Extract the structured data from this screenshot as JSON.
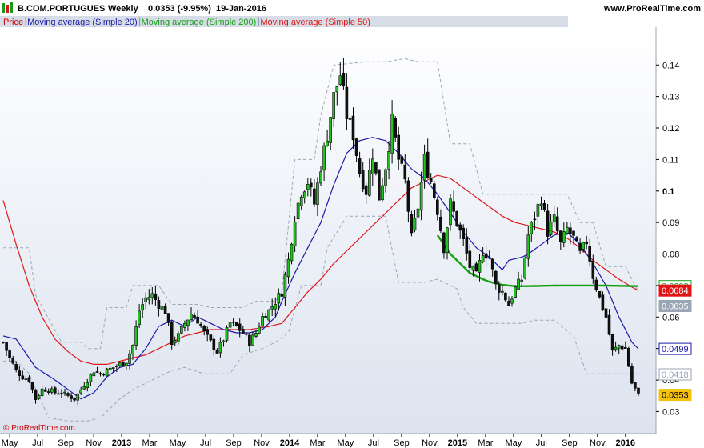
{
  "header": {
    "instrument": "B.COM.PORTUGUES",
    "period": "Weekly",
    "last_change": "0.0353 (-9.95%)",
    "date": "19-Jan-2016",
    "site": "www.ProRealTime.com"
  },
  "legend": [
    {
      "label": "Price",
      "color": "#cc0000"
    },
    {
      "label": "Moving average (Simple 20)",
      "color": "#1a1aa8"
    },
    {
      "label": "Moving average (Simple 200)",
      "color": "#13a013"
    },
    {
      "label": "Moving average (Simple 50)",
      "color": "#e01616"
    }
  ],
  "credit": "© ProRealTime.com",
  "chart_data": {
    "type": "candlestick",
    "x_axis": {
      "tick_labels": [
        "May",
        "Jul",
        "Sep",
        "Nov",
        "2013",
        "Mar",
        "May",
        "Jul",
        "Sep",
        "Nov",
        "2014",
        "Mar",
        "May",
        "Jul",
        "Sep",
        "Nov",
        "2015",
        "Mar",
        "May",
        "Jul",
        "Sep",
        "Nov",
        "2016"
      ],
      "bold_labels": [
        "2013",
        "2014",
        "2015",
        "2016"
      ],
      "week_index_range": [
        0,
        196
      ]
    },
    "y_axis": {
      "ticks": [
        0.03,
        0.04,
        0.05,
        0.06,
        0.07,
        0.08,
        0.09,
        0.1,
        0.11,
        0.12,
        0.13,
        0.14
      ],
      "tick_labels": [
        "0.03",
        "0.04",
        "0.05",
        "0.06",
        "0.07",
        "0.08",
        "0.09",
        "0.1",
        "0.11",
        "0.12",
        "0.13",
        "0.14"
      ],
      "bold_ticks": [
        "0.1"
      ],
      "range": [
        0.023,
        0.152
      ],
      "position": "right"
    },
    "value_badges": [
      {
        "value": 0.0698,
        "label": "0.0698",
        "color": "#13a013",
        "style": "outline"
      },
      {
        "value": 0.0684,
        "label": "0.0684",
        "color": "#e01616",
        "style": "fill"
      },
      {
        "value": 0.0635,
        "label": "0.0635",
        "color": "#9aa6b4",
        "style": "fill"
      },
      {
        "value": 0.0499,
        "label": "0.0499",
        "color": "#1a1aa8",
        "style": "outline"
      },
      {
        "value": 0.0418,
        "label": "0.0418",
        "color": "#9aa6b4",
        "style": "outline"
      },
      {
        "value": 0.0353,
        "label": "0.0353",
        "color": "#f4c20d",
        "style": "fill"
      }
    ],
    "close_series_anchors": [
      [
        0,
        0.052
      ],
      [
        2,
        0.047
      ],
      [
        4,
        0.043
      ],
      [
        6,
        0.041
      ],
      [
        8,
        0.04
      ],
      [
        10,
        0.034
      ],
      [
        12,
        0.037
      ],
      [
        14,
        0.037
      ],
      [
        16,
        0.036
      ],
      [
        18,
        0.036
      ],
      [
        20,
        0.035
      ],
      [
        22,
        0.034
      ],
      [
        24,
        0.037
      ],
      [
        26,
        0.04
      ],
      [
        28,
        0.043
      ],
      [
        30,
        0.042
      ],
      [
        32,
        0.043
      ],
      [
        34,
        0.044
      ],
      [
        36,
        0.045
      ],
      [
        38,
        0.046
      ],
      [
        40,
        0.051
      ],
      [
        42,
        0.062
      ],
      [
        44,
        0.066
      ],
      [
        46,
        0.067
      ],
      [
        48,
        0.064
      ],
      [
        50,
        0.062
      ],
      [
        52,
        0.052
      ],
      [
        54,
        0.054
      ],
      [
        56,
        0.058
      ],
      [
        58,
        0.061
      ],
      [
        60,
        0.059
      ],
      [
        62,
        0.055
      ],
      [
        64,
        0.052
      ],
      [
        66,
        0.049
      ],
      [
        68,
        0.053
      ],
      [
        70,
        0.058
      ],
      [
        72,
        0.057
      ],
      [
        74,
        0.055
      ],
      [
        76,
        0.052
      ],
      [
        78,
        0.055
      ],
      [
        80,
        0.06
      ],
      [
        82,
        0.062
      ],
      [
        84,
        0.065
      ],
      [
        86,
        0.068
      ],
      [
        88,
        0.078
      ],
      [
        90,
        0.092
      ],
      [
        92,
        0.1
      ],
      [
        94,
        0.103
      ],
      [
        96,
        0.096
      ],
      [
        98,
        0.108
      ],
      [
        100,
        0.118
      ],
      [
        102,
        0.13
      ],
      [
        104,
        0.137
      ],
      [
        106,
        0.124
      ],
      [
        108,
        0.118
      ],
      [
        110,
        0.106
      ],
      [
        112,
        0.1
      ],
      [
        114,
        0.112
      ],
      [
        116,
        0.098
      ],
      [
        118,
        0.108
      ],
      [
        120,
        0.122
      ],
      [
        122,
        0.11
      ],
      [
        124,
        0.103
      ],
      [
        126,
        0.085
      ],
      [
        128,
        0.095
      ],
      [
        130,
        0.11
      ],
      [
        132,
        0.103
      ],
      [
        134,
        0.094
      ],
      [
        136,
        0.082
      ],
      [
        138,
        0.096
      ],
      [
        140,
        0.09
      ],
      [
        142,
        0.084
      ],
      [
        144,
        0.076
      ],
      [
        146,
        0.073
      ],
      [
        148,
        0.081
      ],
      [
        150,
        0.079
      ],
      [
        152,
        0.07
      ],
      [
        154,
        0.068
      ],
      [
        156,
        0.064
      ],
      [
        158,
        0.069
      ],
      [
        160,
        0.072
      ],
      [
        162,
        0.086
      ],
      [
        164,
        0.092
      ],
      [
        166,
        0.098
      ],
      [
        168,
        0.087
      ],
      [
        170,
        0.091
      ],
      [
        172,
        0.083
      ],
      [
        174,
        0.088
      ],
      [
        176,
        0.085
      ],
      [
        178,
        0.08
      ],
      [
        180,
        0.084
      ],
      [
        182,
        0.073
      ],
      [
        184,
        0.066
      ],
      [
        186,
        0.06
      ],
      [
        188,
        0.049
      ],
      [
        190,
        0.051
      ],
      [
        192,
        0.05
      ],
      [
        194,
        0.039
      ],
      [
        196,
        0.0353
      ]
    ],
    "sma20_anchors": [
      [
        0,
        0.054
      ],
      [
        4,
        0.053
      ],
      [
        10,
        0.044
      ],
      [
        16,
        0.04
      ],
      [
        20,
        0.037
      ],
      [
        24,
        0.034
      ],
      [
        28,
        0.036
      ],
      [
        32,
        0.041
      ],
      [
        36,
        0.044
      ],
      [
        40,
        0.045
      ],
      [
        44,
        0.05
      ],
      [
        48,
        0.057
      ],
      [
        52,
        0.059
      ],
      [
        56,
        0.057
      ],
      [
        60,
        0.06
      ],
      [
        64,
        0.058
      ],
      [
        68,
        0.056
      ],
      [
        72,
        0.055
      ],
      [
        76,
        0.055
      ],
      [
        80,
        0.056
      ],
      [
        84,
        0.06
      ],
      [
        86,
        0.065
      ],
      [
        90,
        0.074
      ],
      [
        94,
        0.082
      ],
      [
        98,
        0.09
      ],
      [
        102,
        0.102
      ],
      [
        106,
        0.112
      ],
      [
        110,
        0.116
      ],
      [
        114,
        0.117
      ],
      [
        118,
        0.116
      ],
      [
        122,
        0.112
      ],
      [
        126,
        0.107
      ],
      [
        130,
        0.104
      ],
      [
        134,
        0.099
      ],
      [
        138,
        0.093
      ],
      [
        142,
        0.087
      ],
      [
        146,
        0.082
      ],
      [
        150,
        0.079
      ],
      [
        154,
        0.075
      ],
      [
        156,
        0.078
      ],
      [
        160,
        0.079
      ],
      [
        162,
        0.08
      ],
      [
        166,
        0.083
      ],
      [
        170,
        0.086
      ],
      [
        174,
        0.087
      ],
      [
        178,
        0.083
      ],
      [
        182,
        0.077
      ],
      [
        186,
        0.07
      ],
      [
        190,
        0.06
      ],
      [
        194,
        0.052
      ],
      [
        196,
        0.0499
      ]
    ],
    "sma50_anchors": [
      [
        0,
        0.097
      ],
      [
        4,
        0.083
      ],
      [
        8,
        0.07
      ],
      [
        12,
        0.06
      ],
      [
        16,
        0.053
      ],
      [
        20,
        0.049
      ],
      [
        24,
        0.046
      ],
      [
        28,
        0.045
      ],
      [
        32,
        0.045
      ],
      [
        36,
        0.046
      ],
      [
        40,
        0.047
      ],
      [
        44,
        0.048
      ],
      [
        48,
        0.05
      ],
      [
        52,
        0.052
      ],
      [
        56,
        0.054
      ],
      [
        60,
        0.055
      ],
      [
        64,
        0.056
      ],
      [
        70,
        0.056
      ],
      [
        76,
        0.056
      ],
      [
        82,
        0.057
      ],
      [
        86,
        0.058
      ],
      [
        90,
        0.063
      ],
      [
        94,
        0.068
      ],
      [
        98,
        0.072
      ],
      [
        102,
        0.077
      ],
      [
        106,
        0.081
      ],
      [
        110,
        0.085
      ],
      [
        114,
        0.089
      ],
      [
        118,
        0.093
      ],
      [
        122,
        0.097
      ],
      [
        126,
        0.101
      ],
      [
        130,
        0.103
      ],
      [
        134,
        0.105
      ],
      [
        138,
        0.104
      ],
      [
        142,
        0.101
      ],
      [
        146,
        0.098
      ],
      [
        150,
        0.095
      ],
      [
        154,
        0.092
      ],
      [
        158,
        0.09
      ],
      [
        162,
        0.089
      ],
      [
        166,
        0.088
      ],
      [
        170,
        0.087
      ],
      [
        174,
        0.085
      ],
      [
        178,
        0.082
      ],
      [
        182,
        0.078
      ],
      [
        186,
        0.075
      ],
      [
        190,
        0.072
      ],
      [
        194,
        0.0695
      ],
      [
        196,
        0.0684
      ]
    ],
    "sma200_anchors": [
      [
        134,
        0.086
      ],
      [
        136,
        0.083
      ],
      [
        138,
        0.08
      ],
      [
        140,
        0.078
      ],
      [
        142,
        0.076
      ],
      [
        144,
        0.074
      ],
      [
        146,
        0.073
      ],
      [
        148,
        0.072
      ],
      [
        150,
        0.0712
      ],
      [
        154,
        0.0702
      ],
      [
        158,
        0.0698
      ],
      [
        162,
        0.0698
      ],
      [
        166,
        0.0699
      ],
      [
        172,
        0.07
      ],
      [
        178,
        0.07
      ],
      [
        184,
        0.07
      ],
      [
        190,
        0.0699
      ],
      [
        196,
        0.0698
      ]
    ],
    "envelope_upper_anchors": [
      [
        0,
        0.082
      ],
      [
        8,
        0.082
      ],
      [
        10,
        0.067
      ],
      [
        18,
        0.052
      ],
      [
        24,
        0.052
      ],
      [
        26,
        0.05
      ],
      [
        30,
        0.05
      ],
      [
        32,
        0.063
      ],
      [
        38,
        0.063
      ],
      [
        40,
        0.07
      ],
      [
        48,
        0.07
      ],
      [
        52,
        0.064
      ],
      [
        60,
        0.064
      ],
      [
        64,
        0.063
      ],
      [
        74,
        0.063
      ],
      [
        78,
        0.065
      ],
      [
        84,
        0.065
      ],
      [
        86,
        0.068
      ],
      [
        90,
        0.11
      ],
      [
        96,
        0.11
      ],
      [
        98,
        0.124
      ],
      [
        102,
        0.14
      ],
      [
        112,
        0.141
      ],
      [
        118,
        0.141
      ],
      [
        124,
        0.142
      ],
      [
        128,
        0.141
      ],
      [
        134,
        0.141
      ],
      [
        138,
        0.115
      ],
      [
        144,
        0.115
      ],
      [
        148,
        0.099
      ],
      [
        152,
        0.099
      ],
      [
        156,
        0.099
      ],
      [
        160,
        0.099
      ],
      [
        164,
        0.099
      ],
      [
        170,
        0.099
      ],
      [
        174,
        0.099
      ],
      [
        178,
        0.09
      ],
      [
        182,
        0.09
      ],
      [
        186,
        0.076
      ],
      [
        192,
        0.076
      ],
      [
        196,
        0.068
      ]
    ],
    "envelope_lower_anchors": [
      [
        0,
        0.046
      ],
      [
        4,
        0.046
      ],
      [
        8,
        0.042
      ],
      [
        14,
        0.028
      ],
      [
        20,
        0.027
      ],
      [
        26,
        0.027
      ],
      [
        30,
        0.028
      ],
      [
        36,
        0.034
      ],
      [
        40,
        0.037
      ],
      [
        46,
        0.04
      ],
      [
        52,
        0.043
      ],
      [
        56,
        0.044
      ],
      [
        62,
        0.042
      ],
      [
        66,
        0.042
      ],
      [
        70,
        0.042
      ],
      [
        74,
        0.048
      ],
      [
        80,
        0.05
      ],
      [
        84,
        0.052
      ],
      [
        88,
        0.055
      ],
      [
        92,
        0.07
      ],
      [
        98,
        0.07
      ],
      [
        100,
        0.082
      ],
      [
        106,
        0.092
      ],
      [
        112,
        0.092
      ],
      [
        118,
        0.092
      ],
      [
        122,
        0.071
      ],
      [
        126,
        0.071
      ],
      [
        130,
        0.071
      ],
      [
        134,
        0.072
      ],
      [
        138,
        0.07
      ],
      [
        140,
        0.069
      ],
      [
        142,
        0.063
      ],
      [
        146,
        0.058
      ],
      [
        150,
        0.058
      ],
      [
        154,
        0.058
      ],
      [
        160,
        0.058
      ],
      [
        164,
        0.059
      ],
      [
        170,
        0.059
      ],
      [
        176,
        0.054
      ],
      [
        180,
        0.042
      ],
      [
        186,
        0.042
      ],
      [
        192,
        0.042
      ],
      [
        196,
        0.042
      ]
    ]
  }
}
